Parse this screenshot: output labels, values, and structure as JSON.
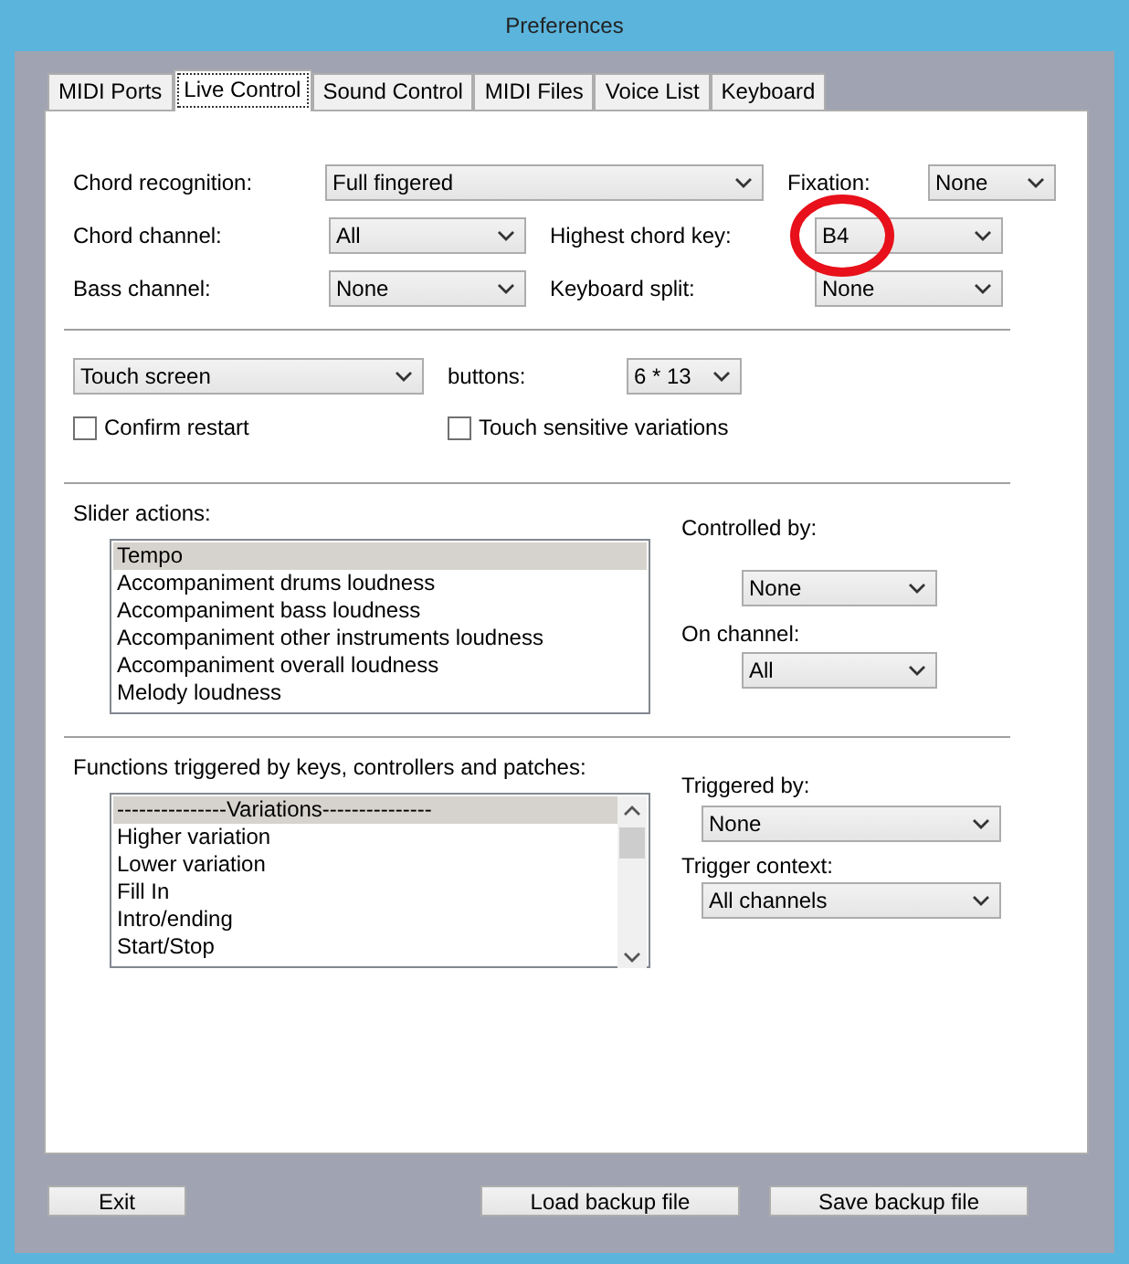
{
  "window": {
    "title": "Preferences"
  },
  "tabs": [
    {
      "label": "MIDI Ports",
      "selected": false
    },
    {
      "label": "Live Control",
      "selected": true
    },
    {
      "label": "Sound Control",
      "selected": false
    },
    {
      "label": "MIDI Files",
      "selected": false
    },
    {
      "label": "Voice List",
      "selected": false
    },
    {
      "label": "Keyboard",
      "selected": false
    }
  ],
  "chord": {
    "recognition": {
      "label": "Chord recognition:",
      "value": "Full fingered"
    },
    "fixation": {
      "label": "Fixation:",
      "value": "None"
    },
    "channel": {
      "label": "Chord channel:",
      "value": "All"
    },
    "highest_key": {
      "label": "Highest chord key:",
      "value": "B4"
    },
    "bass_channel": {
      "label": "Bass channel:",
      "value": "None"
    },
    "keyboard_split": {
      "label": "Keyboard split:",
      "value": "None"
    }
  },
  "touch": {
    "mode": {
      "value": "Touch screen"
    },
    "buttons": {
      "label": "buttons:",
      "value": "6 * 13"
    },
    "checkboxes": [
      {
        "label": "Confirm restart",
        "checked": false
      },
      {
        "label": "Touch sensitive variations",
        "checked": false
      }
    ]
  },
  "sliders": {
    "label": "Slider actions:",
    "items": [
      {
        "label": "Tempo",
        "selected": true
      },
      {
        "label": "Accompaniment drums loudness",
        "selected": false
      },
      {
        "label": "Accompaniment bass loudness",
        "selected": false
      },
      {
        "label": "Accompaniment other instruments loudness",
        "selected": false
      },
      {
        "label": "Accompaniment overall loudness",
        "selected": false
      },
      {
        "label": "Melody loudness",
        "selected": false
      }
    ],
    "controlled_by": {
      "label": "Controlled by:",
      "value": "None"
    },
    "on_channel": {
      "label": "On channel:",
      "value": "All"
    }
  },
  "functions": {
    "label": "Functions triggered by keys, controllers and patches:",
    "items": [
      {
        "label": "---------------Variations---------------",
        "selected": true
      },
      {
        "label": "Higher variation",
        "selected": false
      },
      {
        "label": "Lower variation",
        "selected": false
      },
      {
        "label": "Fill In",
        "selected": false
      },
      {
        "label": "Intro/ending",
        "selected": false
      },
      {
        "label": "Start/Stop",
        "selected": false
      }
    ],
    "triggered_by": {
      "label": "Triggered by:",
      "value": "None"
    },
    "trigger_context": {
      "label": "Trigger context:",
      "value": "All channels"
    }
  },
  "buttons": [
    {
      "label": "Exit"
    },
    {
      "label": "Load backup file"
    },
    {
      "label": "Save backup file"
    }
  ]
}
